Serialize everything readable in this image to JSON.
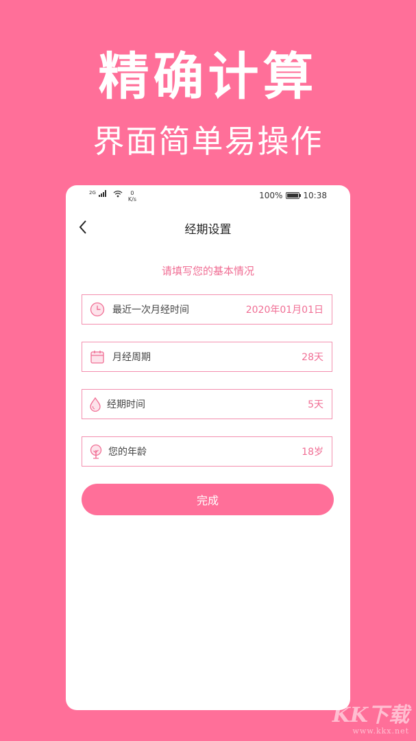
{
  "promo": {
    "headline": "精确计算",
    "subline": "界面简单易操作"
  },
  "status_bar": {
    "network": "2G",
    "speed_value": "0",
    "speed_unit": "K/s",
    "battery_percent": "100%",
    "time": "10:38"
  },
  "nav": {
    "title": "经期设置",
    "back_icon": "chevron-left-icon"
  },
  "form": {
    "prompt": "请填写您的基本情况",
    "rows": [
      {
        "label": "最近一次月经时间",
        "value": "2020年01月01日",
        "icon": "clock-icon"
      },
      {
        "label": "月经周期",
        "value": "28天",
        "icon": "calendar-icon"
      },
      {
        "label": "经期时间",
        "value": "5天",
        "icon": "drop-icon"
      },
      {
        "label": "您的年龄",
        "value": "18岁",
        "icon": "tree-icon"
      }
    ],
    "submit_label": "完成"
  },
  "colors": {
    "background": "#FF6F99",
    "accent": "#F06E94",
    "border": "#F38EAE"
  },
  "watermark": {
    "brand": "KK下载",
    "site": "www.kkx.net"
  }
}
